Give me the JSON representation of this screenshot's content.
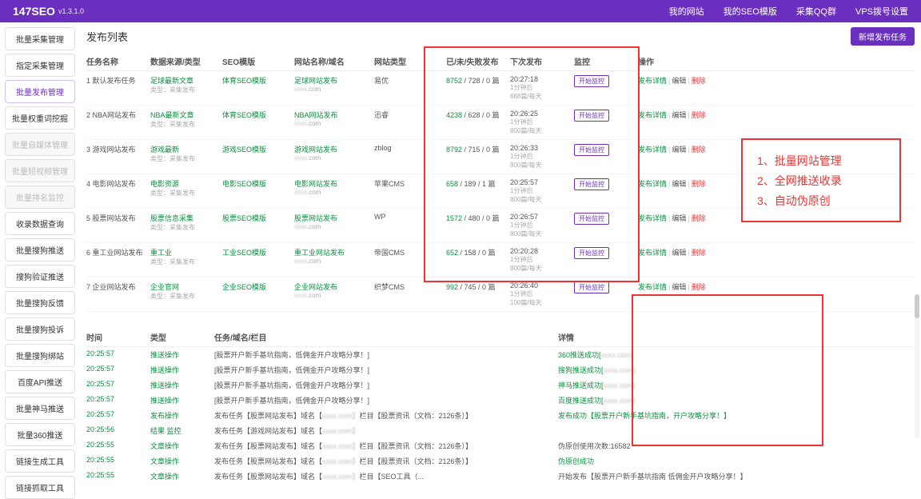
{
  "app": {
    "name": "147SEO",
    "version": "v1.3.1.0"
  },
  "nav": {
    "mysites": "我的网站",
    "mytpl": "我的SEO模版",
    "qq": "采集QQ群",
    "vps": "VPS拨号设置"
  },
  "sidebar": {
    "items": [
      {
        "label": "批量采集管理"
      },
      {
        "label": "指定采集管理"
      },
      {
        "label": "批量发布管理"
      },
      {
        "label": "批量权重词挖掘"
      },
      {
        "label": "批量自媒体管理"
      },
      {
        "label": "批量短视频管理"
      },
      {
        "label": "批量排名监控"
      },
      {
        "label": "收录数据查询"
      },
      {
        "label": "批量搜狗推送"
      },
      {
        "label": "搜狗验证推送"
      },
      {
        "label": "批量搜狗反馈"
      },
      {
        "label": "批量搜狗投诉"
      },
      {
        "label": "批量搜狗绑站"
      },
      {
        "label": "百度API推送"
      },
      {
        "label": "批量神马推送"
      },
      {
        "label": "批量360推送"
      },
      {
        "label": "链接生成工具"
      },
      {
        "label": "链接抓取工具"
      }
    ]
  },
  "list": {
    "title": "发布列表",
    "add_label": "新增发布任务",
    "head": {
      "idx": "任务名称",
      "src": "数据来源/类型",
      "tpl": "SEO模版",
      "site": "网站名称/域名",
      "type": "网站类型",
      "stat": "已/未/失败发布",
      "next": "下次发布",
      "mon": "监控",
      "op": "操作"
    },
    "rows": [
      {
        "idx": "1 默认发布任务",
        "src": "足球最新文章",
        "src_sub": "类型：采集发布",
        "tpl": "体育SEO模版",
        "site": "足球网站发布",
        "site_sub": ".com",
        "type": "易优",
        "g": "8752",
        "s2": "728",
        "s3": "0 篇",
        "next": "20:27:18",
        "n_sub": "1分钟后\n888篇/每天"
      },
      {
        "idx": "2 NBA网站发布",
        "src": "NBA最新文章",
        "src_sub": "类型：采集发布",
        "tpl": "体育SEO模版",
        "site": "NBA网站发布",
        "site_sub": ".com",
        "type": "迅睿",
        "g": "4238",
        "s2": "628",
        "s3": "0 篇",
        "next": "20:26:25",
        "n_sub": "1分钟后\n800篇/每天"
      },
      {
        "idx": "3 游戏网站发布",
        "src": "游戏最新",
        "src_sub": "类型：采集发布",
        "tpl": "游戏SEO模版",
        "site": "游戏网站发布",
        "site_sub": ".com",
        "type": "zblog",
        "g": "8792",
        "s2": "715",
        "s3": "0 篇",
        "next": "20:26:33",
        "n_sub": "1分钟后\n800篇/每天"
      },
      {
        "idx": "4 电影网站发布",
        "src": "电影资源",
        "src_sub": "类型：采集发布",
        "tpl": "电影SEO模版",
        "site": "电影网站发布",
        "site_sub": ".com",
        "type": "苹果CMS",
        "g": "658",
        "s2": "189",
        "s3": "1 篇",
        "next": "20:25:57",
        "n_sub": "1分钟后\n800篇/每天"
      },
      {
        "idx": "5 股票网站发布",
        "src": "股票信息采集",
        "src_sub": "类型：采集发布",
        "tpl": "股票SEO模版",
        "site": "股票网站发布",
        "site_sub": ".com",
        "type": "WP",
        "g": "1572",
        "s2": "480",
        "s3": "0 篇",
        "next": "20:26:57",
        "n_sub": "1分钟后\n800篇/每天"
      },
      {
        "idx": "6 重工业网站发布",
        "src": "重工业",
        "src_sub": "类型：采集发布",
        "tpl": "工业SEO模版",
        "site": "重工业网站发布",
        "site_sub": ".com",
        "type": "帝国CMS",
        "g": "652",
        "s2": "158",
        "s3": "0 篇",
        "next": "20:20:28",
        "n_sub": "1分钟后\n800篇/每天"
      },
      {
        "idx": "7 企业网站发布",
        "src": "企业官网",
        "src_sub": "类型：采集发布",
        "tpl": "企业SEO模版",
        "site": "企业网站发布",
        "site_sub": ".com",
        "type": "织梦CMS",
        "g": "992",
        "s2": "745",
        "s3": "0 篇",
        "next": "20:26:40",
        "n_sub": "1分钟后\n100篇/每天"
      }
    ],
    "mon_label": "开始监控",
    "op_detail": "发布详情",
    "op_edit": "编辑",
    "op_del": "删除"
  },
  "features": {
    "f1": "1、批量网站管理",
    "f2": "2、全网推送收录",
    "f3": "3、自动伪原创"
  },
  "log": {
    "head": {
      "time": "时间",
      "type": "类型",
      "task": "任务/域名/栏目",
      "detail": "详情"
    },
    "rows": [
      {
        "time": "20:25:57",
        "type": "推送操作",
        "task": "[股票开户新手基坑指南，低佣金开户攻略分享！]",
        "detail": "360推送成功[",
        "d_blur": ".com]"
      },
      {
        "time": "20:25:57",
        "type": "推送操作",
        "task": "[股票开户新手基坑指南，低佣金开户攻略分享！]",
        "detail": "搜狗推送成功[",
        "d_blur": ".com]"
      },
      {
        "time": "20:25:57",
        "type": "推送操作",
        "task": "[股票开户新手基坑指南，低佣金开户攻略分享！]",
        "detail": "神马推送成功[",
        "d_blur": ".com]"
      },
      {
        "time": "20:25:57",
        "type": "推送操作",
        "task": "[股票开户新手基坑指南，低佣金开户攻略分享！]",
        "detail": "百度推送成功[",
        "d_blur": ".com]"
      },
      {
        "time": "20:25:57",
        "type": "发布操作",
        "task": "发布任务【股票网站发布】域名【",
        "t_blur": ".com】",
        "t2": "栏目【股票资讯（文档：2126条）】",
        "detail": "发布成功【股票开户新手基坑指南，开户攻略分享！】"
      },
      {
        "time": "20:25:56",
        "type": "结果 监控",
        "task": "发布任务【游戏网站发布】域名【",
        "t_blur": ".com】",
        "detail": ""
      },
      {
        "time": "20:25:55",
        "type": "文章操作",
        "task": "发布任务【股票网站发布】域名【",
        "t_blur": ".com】",
        "t2": "栏目【股票资讯（文档：2126条）】",
        "detail": "伪原创使用次数:16582",
        "d_plain": true
      },
      {
        "time": "20:25:55",
        "type": "文章操作",
        "task": "发布任务【股票网站发布】域名【",
        "t_blur": ".com】",
        "t2": "栏目【股票资讯（文档：2126条）】",
        "detail": "伪原创成功"
      },
      {
        "time": "20:25:55",
        "type": "文章操作",
        "task": "发布任务【股票网站发布】域名【",
        "t_blur": ".com】",
        "t2": "栏目【SEO工具（...",
        "detail": "开始发布【股票开户新手基坑指南 低佣金开户攻略分享！】",
        "d_plain": true
      }
    ]
  }
}
